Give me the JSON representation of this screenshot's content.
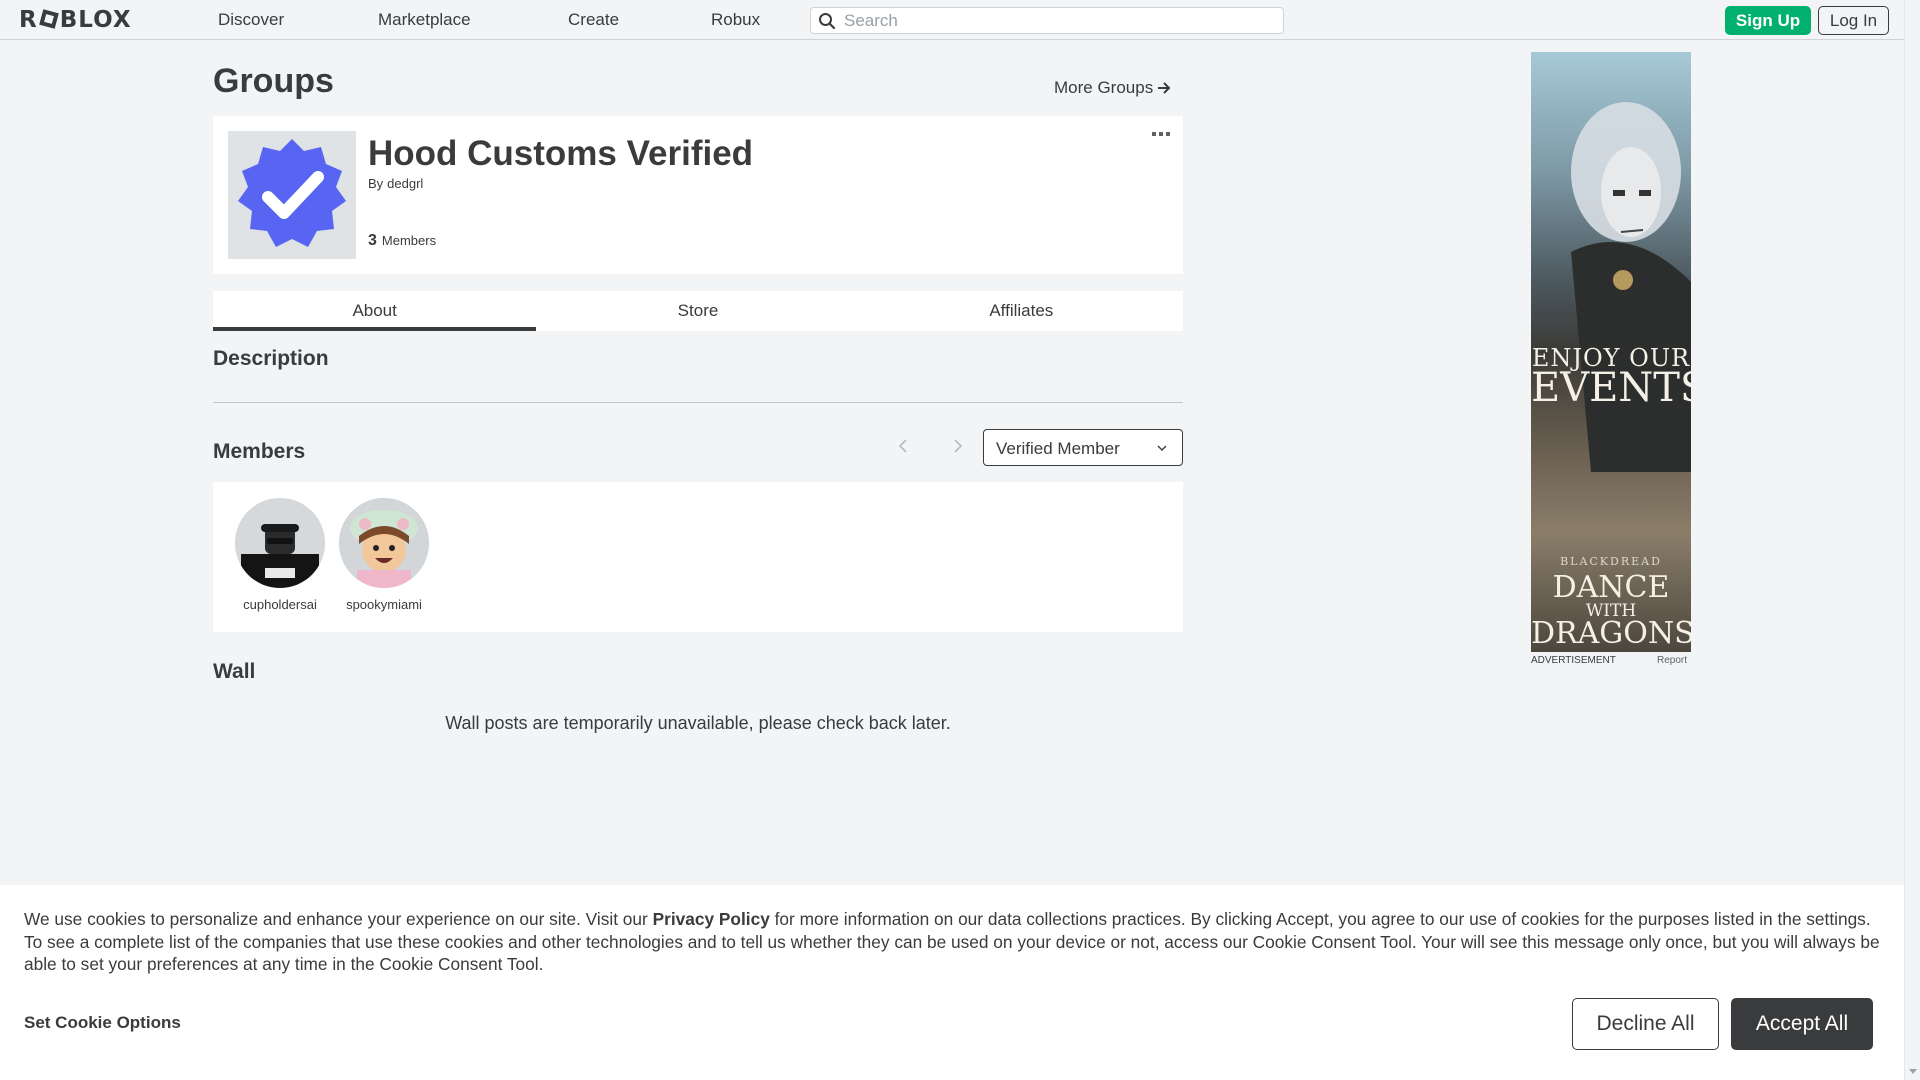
{
  "nav": {
    "logo": "ROBLOX",
    "links": [
      "Discover",
      "Marketplace",
      "Create",
      "Robux"
    ],
    "search_placeholder": "Search",
    "signup_label": "Sign Up",
    "login_label": "Log In"
  },
  "page": {
    "title": "Groups",
    "more_groups_label": "More Groups"
  },
  "group": {
    "name": "Hood Customs Verified",
    "by_label": "By",
    "owner": "dedgrl",
    "member_count": "3",
    "members_label": "Members"
  },
  "tabs": [
    {
      "label": "About",
      "active": true
    },
    {
      "label": "Store",
      "active": false
    },
    {
      "label": "Affiliates",
      "active": false
    }
  ],
  "sections": {
    "description_heading": "Description",
    "members_heading": "Members",
    "wall_heading": "Wall",
    "wall_message": "Wall posts are temporarily unavailable, please check back later."
  },
  "members": {
    "role_selected": "Verified Member",
    "list": [
      {
        "name": "cupholdersai"
      },
      {
        "name": "spookymiami"
      }
    ]
  },
  "ad": {
    "line1": "ENJOY OUR",
    "line2": "EVENTS",
    "brand": "BLACKDREAD",
    "line3": "DANCE",
    "line4": "WITH",
    "line5": "DRAGONS",
    "label": "ADVERTISEMENT",
    "report": "Report"
  },
  "cookie": {
    "text_before": "We use cookies to personalize and enhance your experience on our site. Visit our ",
    "privacy_link": "Privacy Policy",
    "text_after": " for more information on our data collections practices. By clicking Accept, you agree to our use of cookies for the purposes listed in the settings. To see a complete list of the companies that use these cookies and other technologies and to tell us whether they can be used on your device or not, access our Cookie Consent Tool. Your will see this message only once, but you will always be able to set your preferences at any time in the Cookie Consent Tool.",
    "options_label": "Set Cookie Options",
    "decline_label": "Decline All",
    "accept_label": "Accept All"
  },
  "colors": {
    "accent_green": "#00b06f",
    "emblem_blue": "#5865f2",
    "text_dark": "#393b3d",
    "page_bg": "#f2f4f5"
  },
  "icons": [
    "search-icon",
    "arrow-right-icon",
    "more-options-icon",
    "chevron-left-icon",
    "chevron-right-icon",
    "chevron-down-icon",
    "verified-badge-icon"
  ]
}
